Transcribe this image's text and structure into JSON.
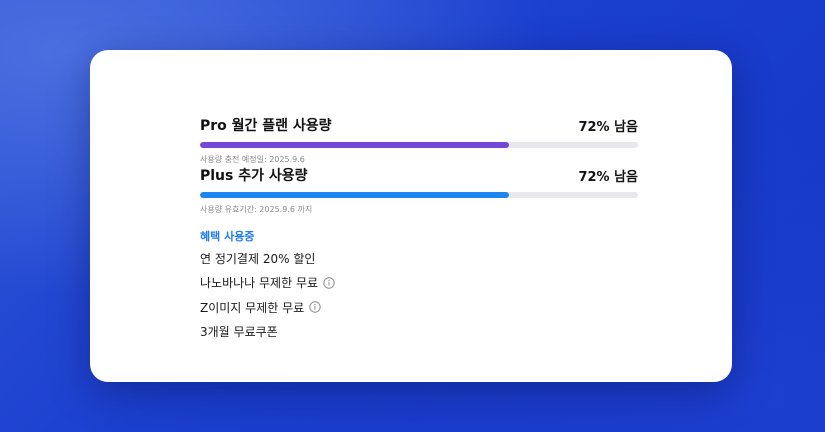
{
  "pro": {
    "title": "Pro 월간 플랜 사용량",
    "remaining": "72% 남음",
    "progress_fraction": 0.705,
    "bar_color": "#7248d6",
    "note": "사용량 충전 예정일: 2025.9.6"
  },
  "plus": {
    "title": "Plus 추가 사용량",
    "remaining": "72% 남음",
    "progress_fraction": 0.705,
    "bar_color": "#1e86f0",
    "note": "사용량 유효기간: 2025.9.6 까지"
  },
  "benefits": {
    "title": "혜택 사용중",
    "items": [
      {
        "label": "연 정기결제 20% 할인",
        "info_icon": false
      },
      {
        "label": "나노바나나 무제한 무료",
        "info_icon": "info-icon"
      },
      {
        "label": "Z이미지 무제한 무료",
        "info_icon": "info-icon"
      },
      {
        "label": "3개월 무료쿠폰",
        "info_icon": false
      }
    ]
  }
}
